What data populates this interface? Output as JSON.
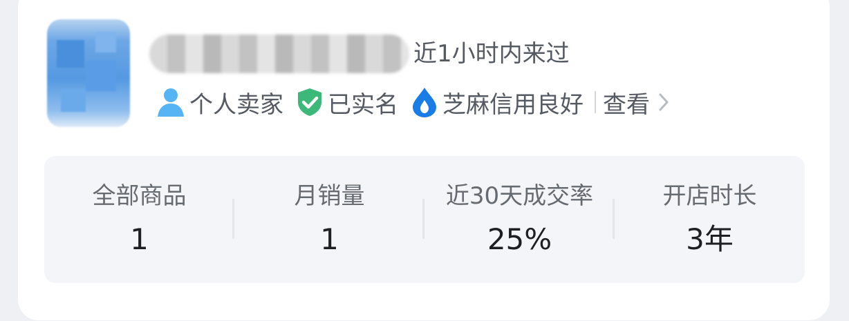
{
  "profile": {
    "active_status": "近1小时内来过",
    "badges": [
      {
        "icon": "person-icon",
        "label": "个人卖家",
        "color": "#56b4f5"
      },
      {
        "icon": "shield-check-icon",
        "label": "已实名",
        "color": "#3cb878"
      },
      {
        "icon": "sesame-drop-icon",
        "label": "芝麻信用良好",
        "color": "#1a7de6"
      }
    ],
    "view_label": "查看"
  },
  "stats": [
    {
      "label": "全部商品",
      "value": "1"
    },
    {
      "label": "月销量",
      "value": "1"
    },
    {
      "label": "近30天成交率",
      "value": "25%"
    },
    {
      "label": "开店时长",
      "value": "3年"
    }
  ]
}
